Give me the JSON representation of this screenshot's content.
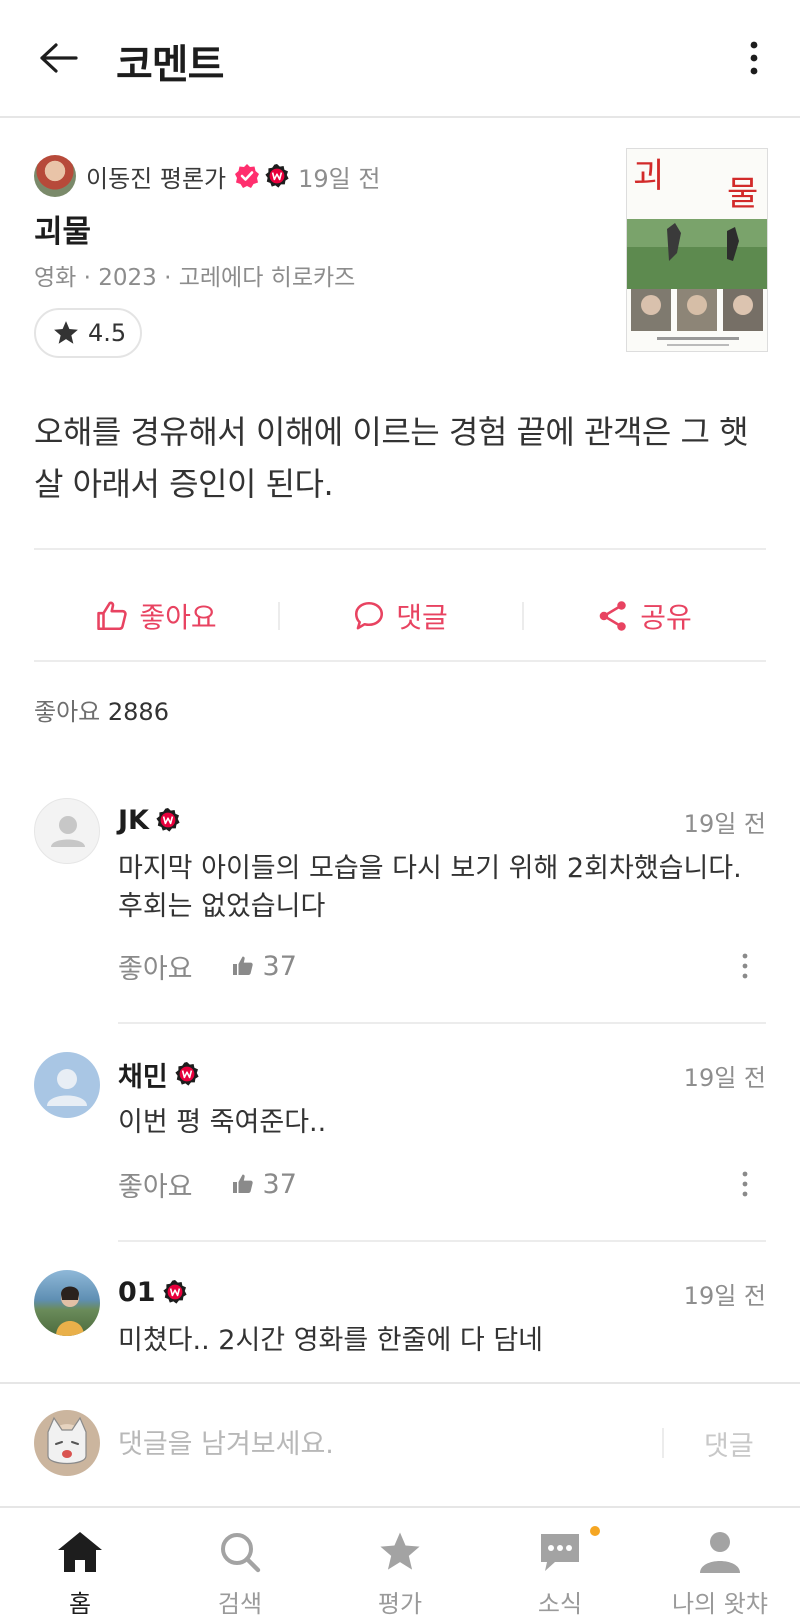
{
  "header": {
    "title": "코멘트"
  },
  "review": {
    "author": "이동진 평론가",
    "time": "19일 전",
    "movie_title": "괴물",
    "meta": "영화 · 2023 · 고레에다 히로카즈",
    "rating": "4.5",
    "poster_text": "괴 물",
    "text": "오해를 경유해서 이해에 이르는 경험 끝에 관객은 그 햇살 아래서 증인이 된다."
  },
  "actions": {
    "like": "좋아요",
    "comment": "댓글",
    "share": "공유"
  },
  "likes": {
    "label": "좋아요",
    "count": "2886"
  },
  "comments": [
    {
      "name": "JK",
      "time": "19일 전",
      "text": "마지막 아이들의 모습을 다시 보기 위해 2회차했습니다. 후회는 없었습니다",
      "like_label": "좋아요",
      "likes": "37"
    },
    {
      "name": "채민",
      "time": "19일 전",
      "text": "이번 평 죽여준다..",
      "like_label": "좋아요",
      "likes": "37"
    },
    {
      "name": "01",
      "time": "19일 전",
      "text": "미쳤다.. 2시간 영화를 한줄에 다 담네"
    }
  ],
  "comment_input": {
    "placeholder": "댓글을 남겨보세요.",
    "submit": "댓글"
  },
  "nav": [
    {
      "label": "홈",
      "icon": "home-icon"
    },
    {
      "label": "검색",
      "icon": "search-icon"
    },
    {
      "label": "평가",
      "icon": "star-icon"
    },
    {
      "label": "소식",
      "icon": "chat-icon"
    },
    {
      "label": "나의 왓챠",
      "icon": "person-icon"
    }
  ],
  "colors": {
    "accent": "#e84361",
    "badge": "#e8003c",
    "verified": "#ff2f6e",
    "notify": "#f5a623"
  }
}
